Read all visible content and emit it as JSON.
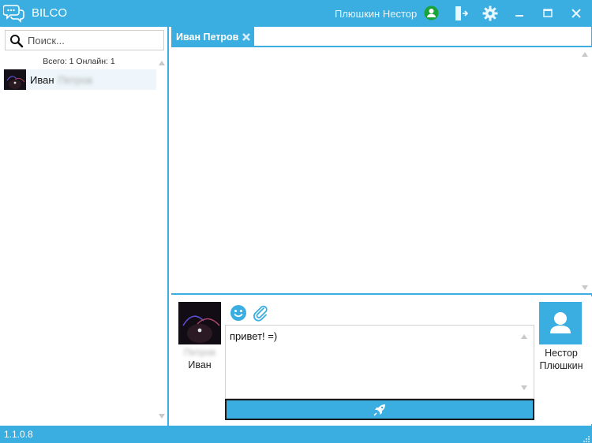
{
  "app": {
    "title": "BILCO",
    "username": "Плюшкин Нестор",
    "accent_color": "#3aaee0",
    "status_color": "#1aa33a"
  },
  "window_buttons": {
    "icons": [
      "logout-icon",
      "gear-icon",
      "minimize-icon",
      "maximize-icon",
      "close-icon"
    ]
  },
  "sidebar": {
    "search_placeholder": "Поиск...",
    "stats": "Всего: 1 Онлайн: 1",
    "contacts": [
      {
        "first_name": "Иван",
        "last_name_blurred": "Петров"
      }
    ]
  },
  "tabs": [
    {
      "label": "Иван Петров"
    }
  ],
  "composer": {
    "peer_surname_blurred": "Петров",
    "peer_name": "Иван",
    "message_text": "привет! =)",
    "self_first_name": "Нестор",
    "self_last_name": "Плюшкин"
  },
  "statusbar": {
    "version": "1.1.0.8"
  }
}
